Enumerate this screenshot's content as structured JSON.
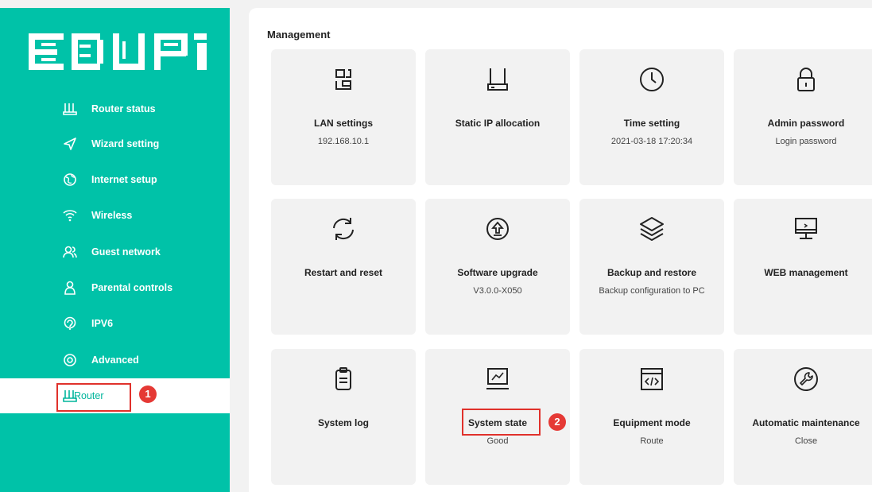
{
  "sidebar": {
    "logo_text": "EDUP",
    "items": [
      {
        "label": "Router status",
        "icon": "router-status-icon"
      },
      {
        "label": "Wizard setting",
        "icon": "wizard-arrow-icon"
      },
      {
        "label": "Internet setup",
        "icon": "globe-icon"
      },
      {
        "label": "Wireless",
        "icon": "wifi-icon"
      },
      {
        "label": "Guest network",
        "icon": "guest-users-icon"
      },
      {
        "label": "Parental controls",
        "icon": "parental-user-icon"
      },
      {
        "label": "IPV6",
        "icon": "ipv6-icon"
      },
      {
        "label": "Advanced",
        "icon": "advanced-settings-icon"
      },
      {
        "label": "Router",
        "icon": "router-icon",
        "active": true
      }
    ]
  },
  "annotations": {
    "step1": "1",
    "step2": "2"
  },
  "management": {
    "title": "Management",
    "tiles": [
      {
        "name": "LAN settings",
        "sub": "192.168.10.1",
        "icon": "lan-icon"
      },
      {
        "name": "Static IP allocation",
        "sub": "",
        "icon": "static-ip-icon"
      },
      {
        "name": "Time setting",
        "sub": "2021-03-18 17:20:34",
        "icon": "clock-icon"
      },
      {
        "name": "Admin password",
        "sub": "Login password",
        "icon": "lock-icon"
      },
      {
        "name": "Restart and reset",
        "sub": "",
        "icon": "restart-icon"
      },
      {
        "name": "Software upgrade",
        "sub": "V3.0.0-X050",
        "icon": "upgrade-icon"
      },
      {
        "name": "Backup and restore",
        "sub": "Backup configuration to PC",
        "icon": "layers-icon"
      },
      {
        "name": "WEB management",
        "sub": "",
        "icon": "monitor-icon"
      },
      {
        "name": "System log",
        "sub": "",
        "icon": "clipboard-icon"
      },
      {
        "name": "System state",
        "sub": "Good",
        "icon": "chart-monitor-icon"
      },
      {
        "name": "Equipment mode",
        "sub": "Route",
        "icon": "code-window-icon"
      },
      {
        "name": "Automatic maintenance",
        "sub": "Close",
        "icon": "wrench-icon"
      }
    ]
  },
  "colors": {
    "brand": "#00c2a8",
    "highlight": "#e0312b",
    "badge": "#e53935"
  }
}
